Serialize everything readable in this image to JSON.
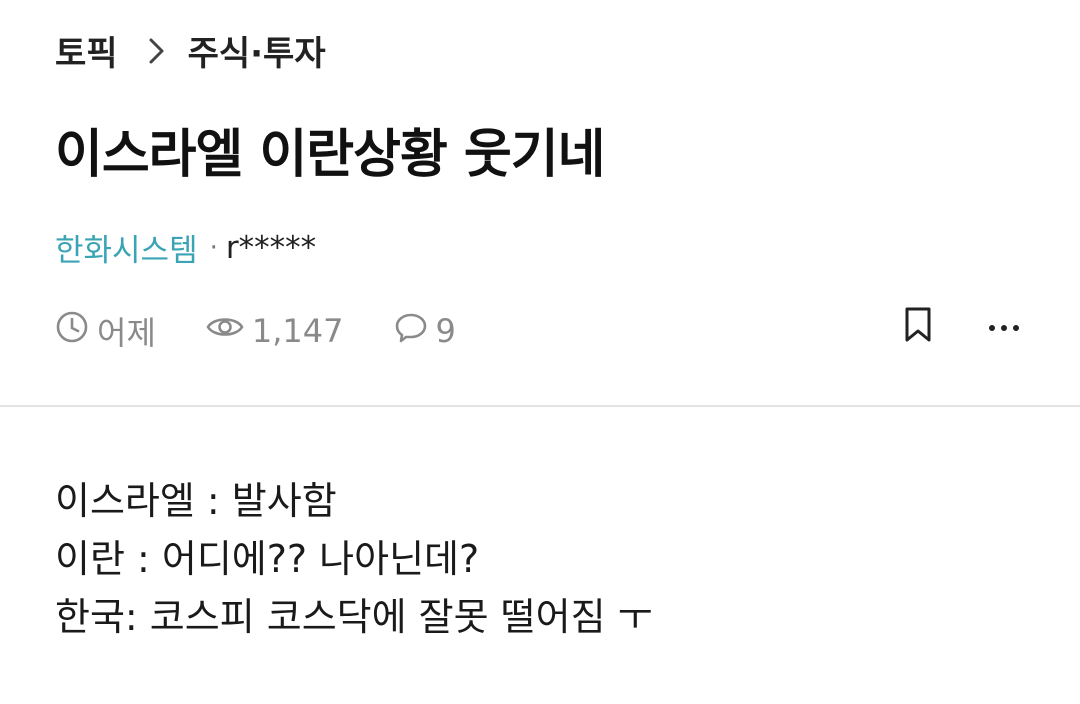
{
  "breadcrumb": {
    "root": "토픽",
    "current": "주식·투자"
  },
  "post": {
    "title": "이스라엘 이란상황 웃기네",
    "company": "한화시스템",
    "separator": "·",
    "author": "r*****",
    "time": "어제",
    "views": "1,147",
    "comments": "9",
    "body_lines": [
      "이스라엘 : 발사함",
      "이란 : 어디에?? 나아닌데?",
      "한국: 코스피 코스닥에 잘못 떨어짐 ㅜ"
    ]
  },
  "icons": {
    "chevron": "chevron-right-icon",
    "clock": "clock-icon",
    "eye": "eye-icon",
    "comment": "comment-icon",
    "bookmark": "bookmark-icon",
    "more": "more-icon"
  },
  "colors": {
    "company": "#3aa4b5",
    "meta": "#8a8a8a",
    "divider": "#e4e4e4"
  }
}
